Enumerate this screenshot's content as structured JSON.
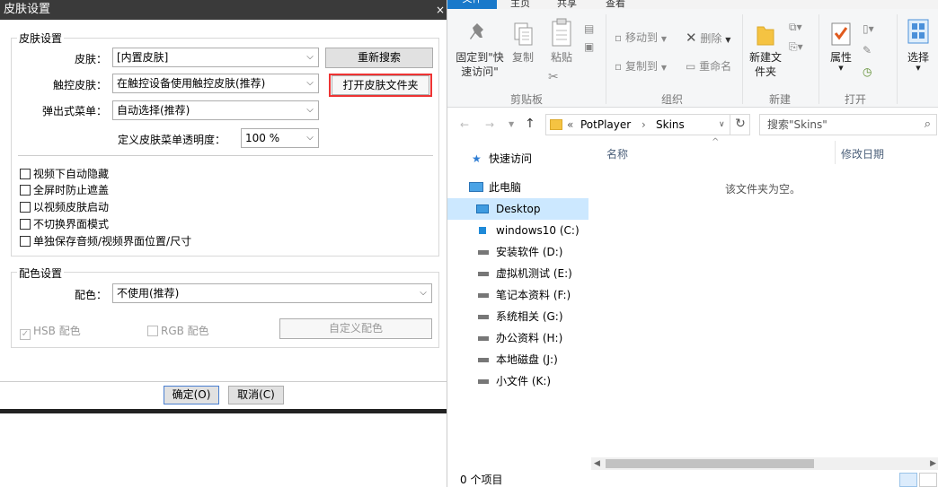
{
  "dialog": {
    "title": "皮肤设置",
    "close": "×",
    "group1_title": "皮肤设置",
    "skin_label": "皮肤：",
    "skin_value": "[内置皮肤]",
    "rescan_button": "重新搜索",
    "touch_label": "触控皮肤：",
    "touch_value": "在触控设备使用触控皮肤(推荐)",
    "open_folder_button": "打开皮肤文件夹",
    "popup_label": "弹出式菜单：",
    "popup_value": "自动选择(推荐)",
    "opacity_label": "定义皮肤菜单透明度：",
    "opacity_value": "100 %",
    "checkboxes": [
      "视频下自动隐藏",
      "全屏时防止遮盖",
      "以视频皮肤启动",
      "不切换界面模式",
      "单独保存音频/视频界面位置/尺寸"
    ],
    "group2_title": "配色设置",
    "color_label": "配色：",
    "color_value": "不使用(推荐)",
    "hsb_label": "HSB 配色",
    "rgb_label": "RGB 配色",
    "custom_color_button": "自定义配色",
    "ok_button": "确定(O)",
    "cancel_button": "取消(C)"
  },
  "explorer": {
    "tabs": [
      "文件",
      "主页",
      "共享",
      "查看"
    ],
    "ribbon": {
      "pin_label": "固定到\"快速访问\"",
      "copy_label": "复制",
      "paste_label": "粘贴",
      "move_to": "移动到",
      "copy_to": "复制到",
      "delete": "删除",
      "rename": "重命名",
      "new_folder": "新建文件夹",
      "properties": "属性",
      "select": "选择",
      "groups": [
        "剪贴板",
        "组织",
        "新建",
        "打开"
      ]
    },
    "address": {
      "prefix": "«",
      "crumbs": [
        "PotPlayer",
        "Skins"
      ],
      "search_placeholder": "搜索\"Skins\""
    },
    "nav": {
      "quick_access": "快速访问",
      "this_pc": "此电脑",
      "desktop": "Desktop",
      "drives": [
        "windows10 (C:)",
        "安装软件 (D:)",
        "虚拟机测试 (E:)",
        "笔记本资料 (F:)",
        "系统相关 (G:)",
        "办公资料 (H:)",
        "本地磁盘 (J:)",
        "小文件 (K:)"
      ]
    },
    "columns": {
      "name": "名称",
      "modified": "修改日期"
    },
    "empty_message": "该文件夹为空。",
    "status": "0 个项目"
  }
}
